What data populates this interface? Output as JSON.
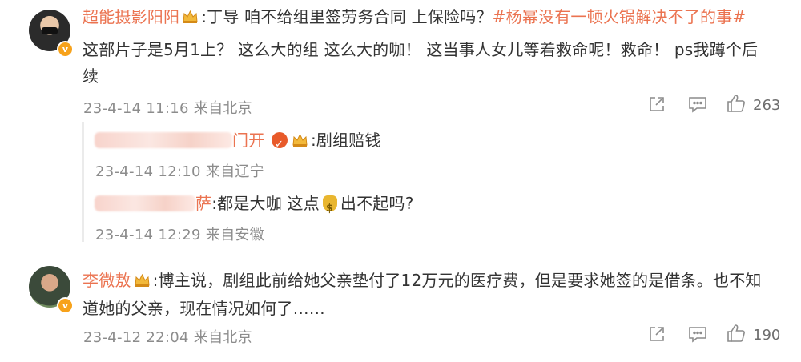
{
  "comments": [
    {
      "username": "超能摄影阳阳",
      "text_a": ":丁导 咱不给组里签劳务合同 上保险吗？",
      "topic": "#杨幂没有一顿火锅解决不了的事#",
      "text_line2": "这部片子是5月1上？ 这么大的组 这么大的咖！ 这当事人女儿等着救命呢！救命！ ps我蹲个后",
      "text_line3": "续",
      "meta": "23-4-14 11:16 来自北京",
      "like_count": "263",
      "replies": [
        {
          "username_visible": "门开",
          "text": ":剧组赔钱",
          "meta": "23-4-14 12:10 来自辽宁"
        },
        {
          "username_visible": "萨",
          "text_a": ":都是大咖 这点",
          "text_b": "出不起吗?",
          "meta": "23-4-14 12:29 来自安徽"
        }
      ]
    },
    {
      "username": "李微敖",
      "text_line1": ":博主说，剧组此前给她父亲垫付了12万元的医疗费，但是要求她签的是借条。也不知",
      "text_line2": "道她的父亲，现在情况如何了……",
      "meta": "23-4-12 22:04 来自北京",
      "like_count": "190"
    }
  ],
  "icons": {
    "verified": "verified-badge-icon",
    "crown": "vip-crown-icon",
    "share": "share-icon",
    "comment": "comment-icon",
    "like": "like-icon",
    "medal": "fan-medal-icon",
    "money_bag": "money-bag-emoji-icon"
  },
  "colors": {
    "username": "#eb7350",
    "meta": "#8c8c8c",
    "text": "#333333"
  }
}
